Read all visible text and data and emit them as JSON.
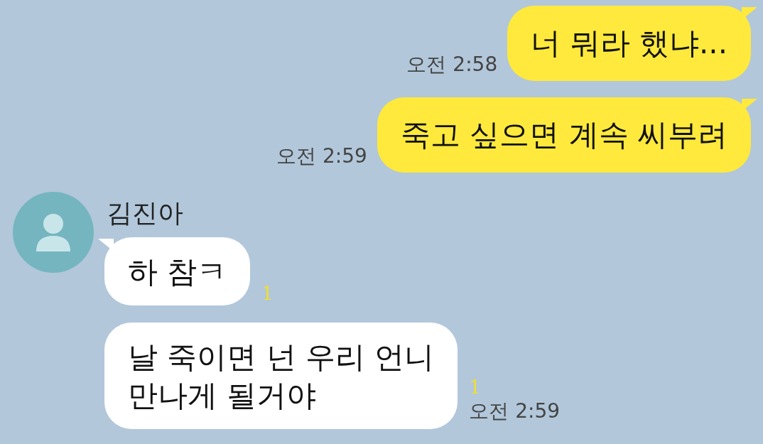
{
  "messages": [
    {
      "kind": "sent",
      "text": "너 뭐라 했냐...",
      "time": "오전 2:58"
    },
    {
      "kind": "sent",
      "text": "죽고 싶으면 계속 씨부려",
      "time": "오전 2:59"
    },
    {
      "kind": "received",
      "sender": "김진아",
      "text": "하 참ㅋ",
      "unread": "1"
    },
    {
      "kind": "received",
      "text": "날 죽이면 넌 우리 언니\n만나게 될거야",
      "unread": "1",
      "time": "오전 2:59"
    }
  ]
}
